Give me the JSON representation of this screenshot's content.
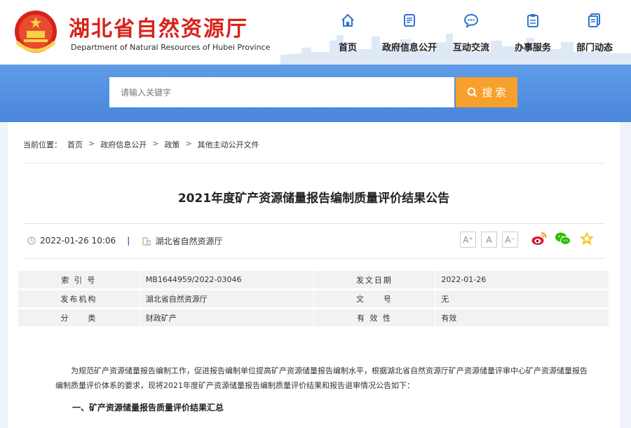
{
  "header": {
    "site_title": "湖北省自然资源厅",
    "site_subtitle": "Department of Natural Resources of Hubei Province",
    "nav": [
      {
        "label": "首页",
        "icon": "home-icon"
      },
      {
        "label": "政府信息公开",
        "icon": "document-icon"
      },
      {
        "label": "互动交流",
        "icon": "chat-icon"
      },
      {
        "label": "办事服务",
        "icon": "clipboard-icon"
      },
      {
        "label": "部门动态",
        "icon": "news-icon"
      }
    ]
  },
  "search": {
    "placeholder": "请输入关键字",
    "button_label": "搜 索",
    "icon": "search-icon"
  },
  "breadcrumb": {
    "prefix": "当前位置：",
    "items": [
      "首页",
      "政府信息公开",
      "政策",
      "其他主动公开文件"
    ],
    "separator": ">"
  },
  "article": {
    "title": "2021年度矿产资源储量报告编制质量评价结果公告",
    "date": "2022-01-26 10:06",
    "source": "湖北省自然资源厅",
    "font_sizes": [
      "A⁺",
      "A",
      "A⁻"
    ],
    "shares": [
      "weibo-icon",
      "wechat-icon",
      "favorite-icon"
    ]
  },
  "info_table": [
    {
      "k1": "索 引 号",
      "v1": "MB1644959/2022-03046",
      "k2": "发文日期",
      "v2": "2022-01-26"
    },
    {
      "k1": "发布机构",
      "v1": "湖北省自然资源厅",
      "k2": "文　　号",
      "v2": "无"
    },
    {
      "k1": "分　　类",
      "v1": "财政矿产",
      "k2": "有 效 性",
      "v2": "有效"
    }
  ],
  "body": {
    "paragraph": "为规范矿产资源储量报告编制工作，促进报告编制单位提高矿产资源储量报告编制水平，根据湖北省自然资源厅矿产资源储量评审中心矿产资源储量报告编制质量评价体系的要求，现将2021年度矿产资源储量报告编制质量评价结果和报告退审情况公告如下：",
    "section_1": "一、矿产资源储量报告质量评价结果汇总"
  },
  "colors": {
    "brand_red": "#d7231b",
    "band_blue": "#4a86da",
    "search_orange": "#f7a02c",
    "nav_icon_blue": "#2f72d2"
  }
}
